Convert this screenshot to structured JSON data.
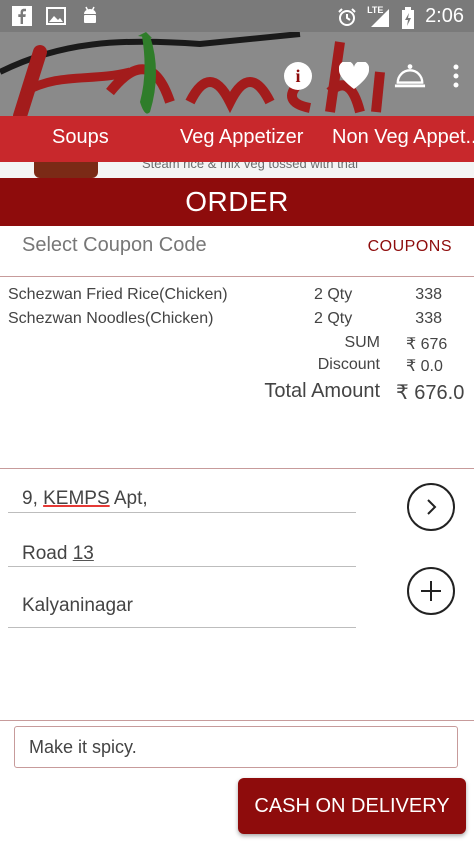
{
  "status_bar": {
    "time": "2:06",
    "network": "LTE",
    "icons": [
      "facebook-icon",
      "image-icon",
      "android-icon",
      "alarm-icon",
      "signal-icon",
      "battery-icon"
    ]
  },
  "header": {
    "brand_name": "Kimchi",
    "actions": [
      "info-icon",
      "heart-icon",
      "service-bell-icon",
      "more-vert-icon"
    ]
  },
  "tabs": [
    {
      "label": "Soups"
    },
    {
      "label": "Veg Appetizer"
    },
    {
      "label": "Non Veg Appet..."
    }
  ],
  "peek": {
    "snippet": "Steam rice & mix veg tossed with thai"
  },
  "order": {
    "title": "ORDER",
    "coupon_placeholder": "Select Coupon Code",
    "coupon_button": "COUPONS",
    "items": [
      {
        "name": "Schezwan Fried Rice(Chicken)",
        "qty": "2 Qty",
        "price": "338"
      },
      {
        "name": "Schezwan Noodles(Chicken)",
        "qty": "2 Qty",
        "price": "338"
      }
    ],
    "sum_label": "SUM",
    "sum_value": "₹ 676",
    "discount_label": "Discount",
    "discount_value": "₹ 0.0",
    "total_label": "Total Amount",
    "total_value": "₹ 676.0"
  },
  "address": {
    "line1_prefix": "9, ",
    "line1_word": "KEMPS",
    "line1_suffix": " Apt,",
    "line2_prefix": "Road ",
    "line2_number": "13",
    "line3": "Kalyaninagar"
  },
  "note": {
    "value": "Make it spicy."
  },
  "cod_button": "CASH ON DELIVERY",
  "colors": {
    "primary_dark": "#8e0c0c",
    "primary": "#c8282c",
    "header_gray": "#8a8a8a"
  }
}
